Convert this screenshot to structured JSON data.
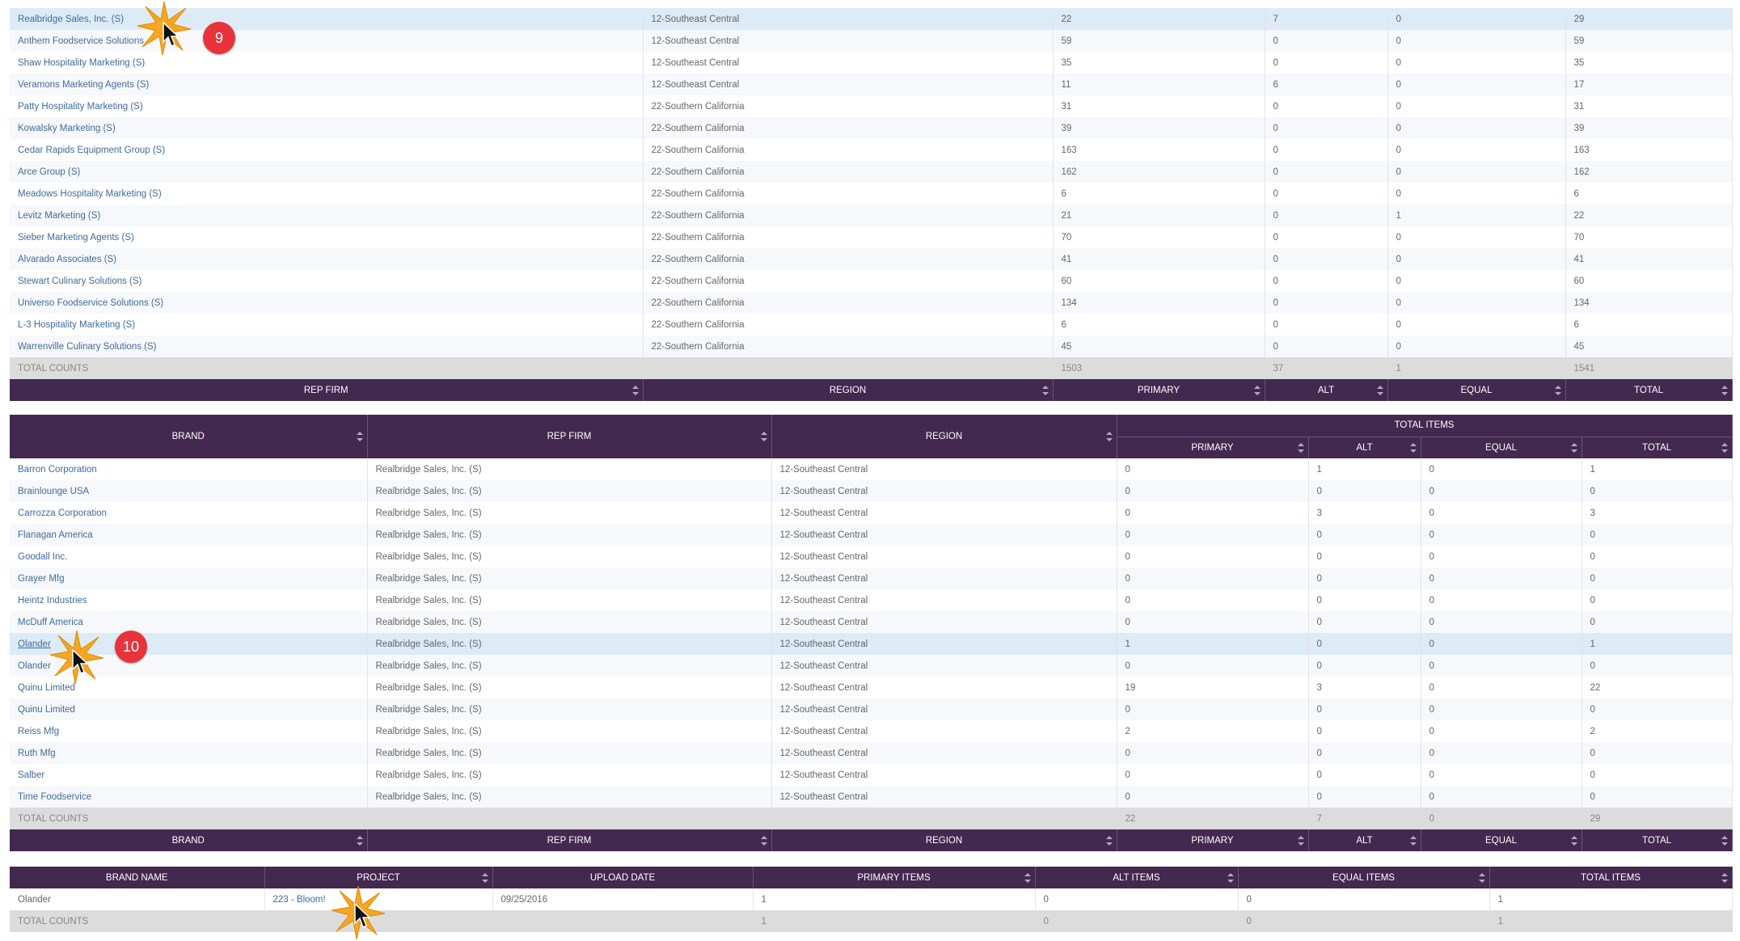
{
  "table1": {
    "rows": [
      {
        "rep": "Realbridge Sales, Inc. (S)",
        "region": "12-Southeast Central",
        "primary": "22",
        "alt": "7",
        "equal": "0",
        "total": "29",
        "highlight": true
      },
      {
        "rep": "Anthem Foodservice Solutions",
        "region": "12-Southeast Central",
        "primary": "59",
        "alt": "0",
        "equal": "0",
        "total": "59"
      },
      {
        "rep": "Shaw Hospitality Marketing (S)",
        "region": "12-Southeast Central",
        "primary": "35",
        "alt": "0",
        "equal": "0",
        "total": "35"
      },
      {
        "rep": "Veramons Marketing Agents (S)",
        "region": "12-Southeast Central",
        "primary": "11",
        "alt": "6",
        "equal": "0",
        "total": "17"
      },
      {
        "rep": "Patty Hospitality Marketing (S)",
        "region": "22-Southern California",
        "primary": "31",
        "alt": "0",
        "equal": "0",
        "total": "31"
      },
      {
        "rep": "Kowalsky Marketing (S)",
        "region": "22-Southern California",
        "primary": "39",
        "alt": "0",
        "equal": "0",
        "total": "39"
      },
      {
        "rep": "Cedar Rapids Equipment Group (S)",
        "region": "22-Southern California",
        "primary": "163",
        "alt": "0",
        "equal": "0",
        "total": "163"
      },
      {
        "rep": "Arce Group (S)",
        "region": "22-Southern California",
        "primary": "162",
        "alt": "0",
        "equal": "0",
        "total": "162"
      },
      {
        "rep": "Meadows Hospitality Marketing (S)",
        "region": "22-Southern California",
        "primary": "6",
        "alt": "0",
        "equal": "0",
        "total": "6"
      },
      {
        "rep": "Levitz Marketing (S)",
        "region": "22-Southern California",
        "primary": "21",
        "alt": "0",
        "equal": "1",
        "total": "22"
      },
      {
        "rep": "Sieber Marketing Agents (S)",
        "region": "22-Southern California",
        "primary": "70",
        "alt": "0",
        "equal": "0",
        "total": "70"
      },
      {
        "rep": "Alvarado Associates (S)",
        "region": "22-Southern California",
        "primary": "41",
        "alt": "0",
        "equal": "0",
        "total": "41"
      },
      {
        "rep": "Stewart Culinary Solutions (S)",
        "region": "22-Southern California",
        "primary": "60",
        "alt": "0",
        "equal": "0",
        "total": "60"
      },
      {
        "rep": "Universo Foodservice Solutions (S)",
        "region": "22-Southern California",
        "primary": "134",
        "alt": "0",
        "equal": "0",
        "total": "134"
      },
      {
        "rep": "L-3 Hospitality Marketing (S)",
        "region": "22-Southern California",
        "primary": "6",
        "alt": "0",
        "equal": "0",
        "total": "6"
      },
      {
        "rep": "Warrenville Culinary Solutions (S)",
        "region": "22-Southern California",
        "primary": "45",
        "alt": "0",
        "equal": "0",
        "total": "45"
      }
    ],
    "total": {
      "label": "TOTAL COUNTS",
      "primary": "1503",
      "alt": "37",
      "equal": "1",
      "total": "1541"
    },
    "footer": [
      "REP FIRM",
      "REGION",
      "PRIMARY",
      "ALT",
      "EQUAL",
      "TOTAL"
    ]
  },
  "table2": {
    "header": {
      "brand": "BRAND",
      "rep": "REP FIRM",
      "region": "REGION",
      "group": "TOTAL ITEMS",
      "primary": "PRIMARY",
      "alt": "ALT",
      "equal": "EQUAL",
      "total": "TOTAL"
    },
    "rows": [
      {
        "brand": "Barron Corporation",
        "rep": "Realbridge Sales, Inc. (S)",
        "region": "12-Southeast Central",
        "primary": "0",
        "alt": "1",
        "equal": "0",
        "total": "1"
      },
      {
        "brand": "Brainlounge USA",
        "rep": "Realbridge Sales, Inc. (S)",
        "region": "12-Southeast Central",
        "primary": "0",
        "alt": "0",
        "equal": "0",
        "total": "0"
      },
      {
        "brand": "Carrozza Corporation",
        "rep": "Realbridge Sales, Inc. (S)",
        "region": "12-Southeast Central",
        "primary": "0",
        "alt": "3",
        "equal": "0",
        "total": "3"
      },
      {
        "brand": "Flanagan America",
        "rep": "Realbridge Sales, Inc. (S)",
        "region": "12-Southeast Central",
        "primary": "0",
        "alt": "0",
        "equal": "0",
        "total": "0"
      },
      {
        "brand": "Goodall Inc.",
        "rep": "Realbridge Sales, Inc. (S)",
        "region": "12-Southeast Central",
        "primary": "0",
        "alt": "0",
        "equal": "0",
        "total": "0"
      },
      {
        "brand": "Grayer Mfg",
        "rep": "Realbridge Sales, Inc. (S)",
        "region": "12-Southeast Central",
        "primary": "0",
        "alt": "0",
        "equal": "0",
        "total": "0"
      },
      {
        "brand": "Heintz Industries",
        "rep": "Realbridge Sales, Inc. (S)",
        "region": "12-Southeast Central",
        "primary": "0",
        "alt": "0",
        "equal": "0",
        "total": "0"
      },
      {
        "brand": "McDuff America",
        "rep": "Realbridge Sales, Inc. (S)",
        "region": "12-Southeast Central",
        "primary": "0",
        "alt": "0",
        "equal": "0",
        "total": "0"
      },
      {
        "brand": "Olander",
        "rep": "Realbridge Sales, Inc. (S)",
        "region": "12-Southeast Central",
        "primary": "1",
        "alt": "0",
        "equal": "0",
        "total": "1",
        "highlight": true
      },
      {
        "brand": "Olander",
        "rep": "Realbridge Sales, Inc. (S)",
        "region": "12-Southeast Central",
        "primary": "0",
        "alt": "0",
        "equal": "0",
        "total": "0"
      },
      {
        "brand": "Quinu Limited",
        "rep": "Realbridge Sales, Inc. (S)",
        "region": "12-Southeast Central",
        "primary": "19",
        "alt": "3",
        "equal": "0",
        "total": "22"
      },
      {
        "brand": "Quinu Limited",
        "rep": "Realbridge Sales, Inc. (S)",
        "region": "12-Southeast Central",
        "primary": "0",
        "alt": "0",
        "equal": "0",
        "total": "0"
      },
      {
        "brand": "Reiss Mfg",
        "rep": "Realbridge Sales, Inc. (S)",
        "region": "12-Southeast Central",
        "primary": "2",
        "alt": "0",
        "equal": "0",
        "total": "2"
      },
      {
        "brand": "Ruth Mfg",
        "rep": "Realbridge Sales, Inc. (S)",
        "region": "12-Southeast Central",
        "primary": "0",
        "alt": "0",
        "equal": "0",
        "total": "0"
      },
      {
        "brand": "Salber",
        "rep": "Realbridge Sales, Inc. (S)",
        "region": "12-Southeast Central",
        "primary": "0",
        "alt": "0",
        "equal": "0",
        "total": "0"
      },
      {
        "brand": "Time Foodservice",
        "rep": "Realbridge Sales, Inc. (S)",
        "region": "12-Southeast Central",
        "primary": "0",
        "alt": "0",
        "equal": "0",
        "total": "0"
      }
    ],
    "total": {
      "label": "TOTAL COUNTS",
      "primary": "22",
      "alt": "7",
      "equal": "0",
      "total": "29"
    },
    "footer": [
      "BRAND",
      "REP FIRM",
      "REGION",
      "PRIMARY",
      "ALT",
      "EQUAL",
      "TOTAL"
    ]
  },
  "table3": {
    "header": [
      "BRAND NAME",
      "PROJECT",
      "UPLOAD DATE",
      "PRIMARY ITEMS",
      "ALT ITEMS",
      "EQUAL ITEMS",
      "TOTAL ITEMS"
    ],
    "rows": [
      {
        "brand": "Olander",
        "project": "223 - Bloom!",
        "date": "09/25/2016",
        "primary": "1",
        "alt": "0",
        "equal": "0",
        "total": "1"
      }
    ],
    "total": {
      "label": "TOTAL COUNTS",
      "primary": "1",
      "alt": "0",
      "equal": "0",
      "total": "1"
    }
  },
  "annotations": {
    "step9": "9",
    "step10": "10"
  },
  "colors": {
    "header_bg": "#43284f",
    "badge": "#e8333a",
    "highlight": "#dcebf6",
    "total_bg": "#dcdcdc",
    "link": "#3f6b9c"
  }
}
